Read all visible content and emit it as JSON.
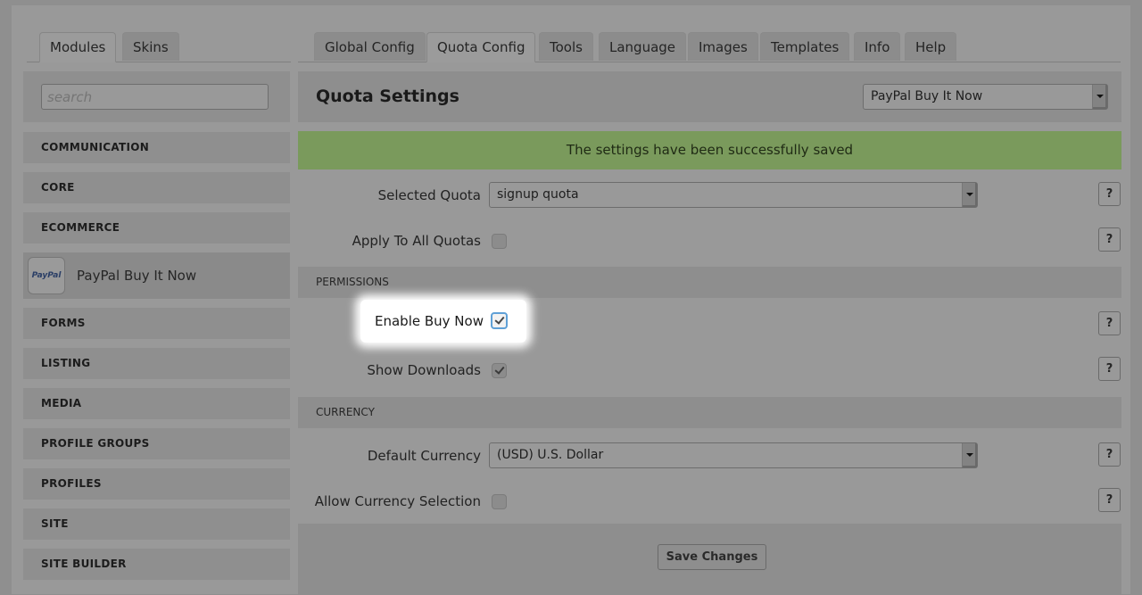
{
  "left_tabs": [
    {
      "label": "Modules",
      "active": true
    },
    {
      "label": "Skins",
      "active": false
    }
  ],
  "right_tabs": [
    {
      "label": "Global Config",
      "active": false
    },
    {
      "label": "Quota Config",
      "active": true
    },
    {
      "label": "Tools",
      "active": false
    },
    {
      "label": "Language",
      "active": false
    },
    {
      "label": "Images",
      "active": false
    },
    {
      "label": "Templates",
      "active": false
    },
    {
      "label": "Info",
      "active": false
    },
    {
      "label": "Help",
      "active": false
    }
  ],
  "sidebar": {
    "search_placeholder": "search",
    "categories": [
      "COMMUNICATION",
      "CORE",
      "ECOMMERCE"
    ],
    "active_module": {
      "logo_text": "PayPal",
      "label": "PayPal Buy It Now"
    },
    "categories_after": [
      "FORMS",
      "LISTING",
      "MEDIA",
      "PROFILE GROUPS",
      "PROFILES",
      "SITE",
      "SITE BUILDER"
    ]
  },
  "main": {
    "title": "Quota Settings",
    "module_select": "PayPal Buy It Now",
    "success_message": "The settings have been successfully saved",
    "selected_quota": {
      "label": "Selected Quota",
      "value": "signup quota"
    },
    "apply_all": {
      "label": "Apply To All Quotas",
      "checked": false
    },
    "permissions_header": "PERMISSIONS",
    "enable_buy_now": {
      "label": "Enable Buy Now",
      "checked": true
    },
    "show_downloads": {
      "label": "Show Downloads",
      "checked": true
    },
    "currency_header": "CURRENCY",
    "default_currency": {
      "label": "Default Currency",
      "value": "(USD) U.S. Dollar"
    },
    "allow_currency": {
      "label": "Allow Currency Selection",
      "checked": false
    },
    "help_label": "?",
    "save_label": "Save Changes"
  },
  "colors": {
    "success": "#7a9a5c",
    "focus": "#5fa0d6"
  }
}
